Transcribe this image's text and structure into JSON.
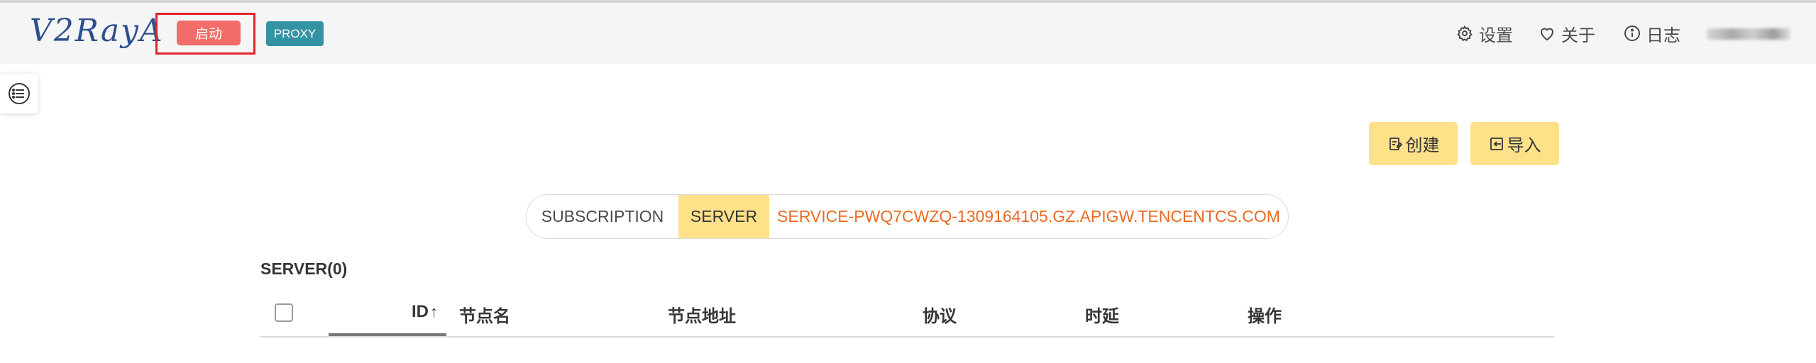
{
  "header": {
    "logo_text": "V2RayA",
    "start_label": "启动",
    "proxy_tag": "PROXY",
    "nav": {
      "settings_label": "设置",
      "about_label": "关于",
      "log_label": "日志"
    }
  },
  "actions": {
    "create_label": "创建",
    "import_label": "导入"
  },
  "tabs": [
    {
      "label": "SUBSCRIPTION"
    },
    {
      "label": "SERVER"
    },
    {
      "label": "SERVICE-PWQ7CWZQ-1309164105.GZ.APIGW.TENCENTCS.COM"
    }
  ],
  "server_section": {
    "title": "SERVER(0)",
    "columns": [
      "ID",
      "节点名",
      "节点地址",
      "协议",
      "时延",
      "操作"
    ],
    "sort_indicator": "↑"
  },
  "colors": {
    "start_button": "#f26d69",
    "proxy_tag": "#3393a2",
    "accent_yellow": "#ffe18a",
    "service_tab_text": "#ea6a22",
    "highlight_box": "#e0242b"
  },
  "icons": [
    "gear-icon",
    "heart-icon",
    "info-icon",
    "menu-list-icon",
    "create-doc-icon",
    "import-icon",
    "sort-up-icon"
  ]
}
